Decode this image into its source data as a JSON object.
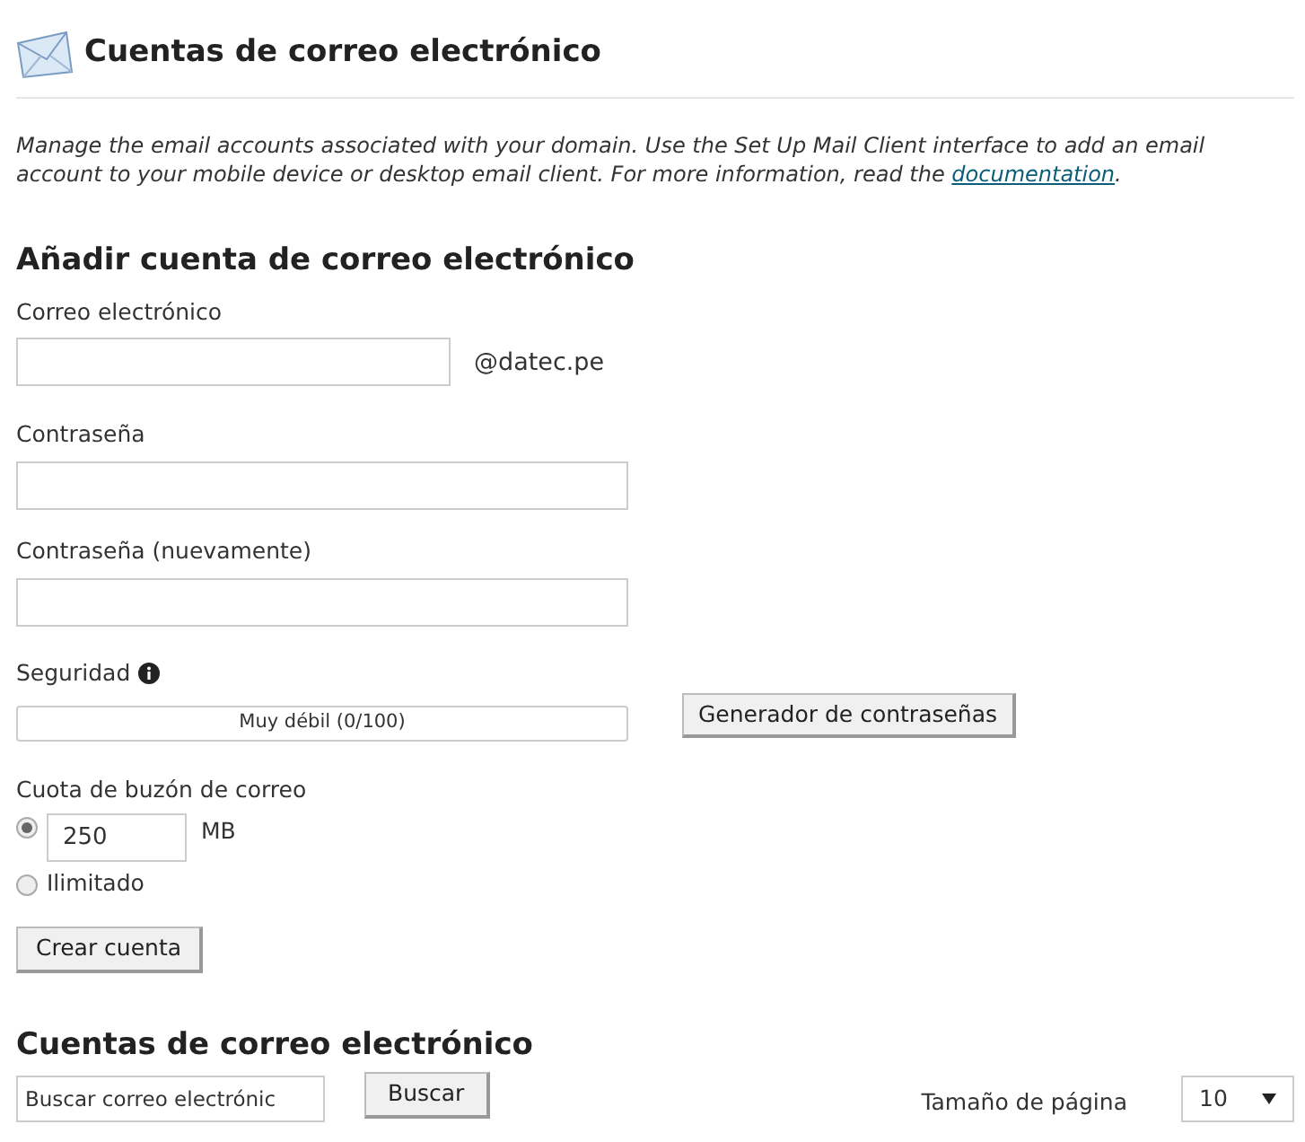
{
  "page_title": "Cuentas de correo electrónico",
  "description": {
    "text": "Manage the email accounts associated with your domain. Use the Set Up Mail Client interface to add an email account to your mobile device or desktop email client. For more information, read the ",
    "link": "documentation",
    "end": "."
  },
  "add_form": {
    "heading": "Añadir cuenta de correo electrónico",
    "email": {
      "label": "Correo electrónico",
      "domain": "@datec.pe"
    },
    "password": {
      "label": "Contraseña"
    },
    "password_again": {
      "label": "Contraseña (nuevamente)"
    },
    "strength": {
      "label": "Seguridad",
      "level": 0,
      "reading": "Muy débil (0/100)"
    },
    "generator_button": "Generador de contraseñas",
    "quota": {
      "label": "Cuota de buzón de correo",
      "options": [
        {
          "kind": "amount",
          "value": "250",
          "unit": "MB",
          "selected": true
        },
        {
          "kind": "unlimited",
          "label": "Ilimitado",
          "selected": false
        }
      ]
    },
    "create_button": "Crear cuenta"
  },
  "accounts": {
    "heading": "Cuentas de correo electrónico",
    "search": {
      "placeholder": "Buscar correo electrónic"
    },
    "search_button": "Buscar",
    "page_size": {
      "label": "Tamaño de página",
      "value": "10"
    }
  }
}
